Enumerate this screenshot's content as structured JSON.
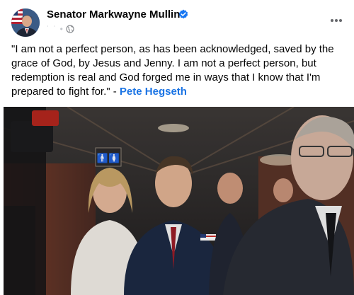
{
  "post": {
    "author": "Senator Markwayne Mullin",
    "timestamp": "˙ ˙ •",
    "audience_icon": "globe-icon",
    "verified_icon": "verified-badge-icon",
    "more_icon": "more-options-icon",
    "quote_text": "\"I am not a perfect person, as has been acknowledged, saved by the grace of God, by Jesus and Jenny. I am not a perfect person, but redemption is real and God forged me in ways that I know that I'm prepared to fight for.\" - ",
    "mention": "Pete Hegseth",
    "photo_sign": "🚹🚺"
  },
  "colors": {
    "verified_blue": "#1877f2",
    "link_blue": "#1b74e4",
    "muted_text": "#b0b3b8"
  }
}
